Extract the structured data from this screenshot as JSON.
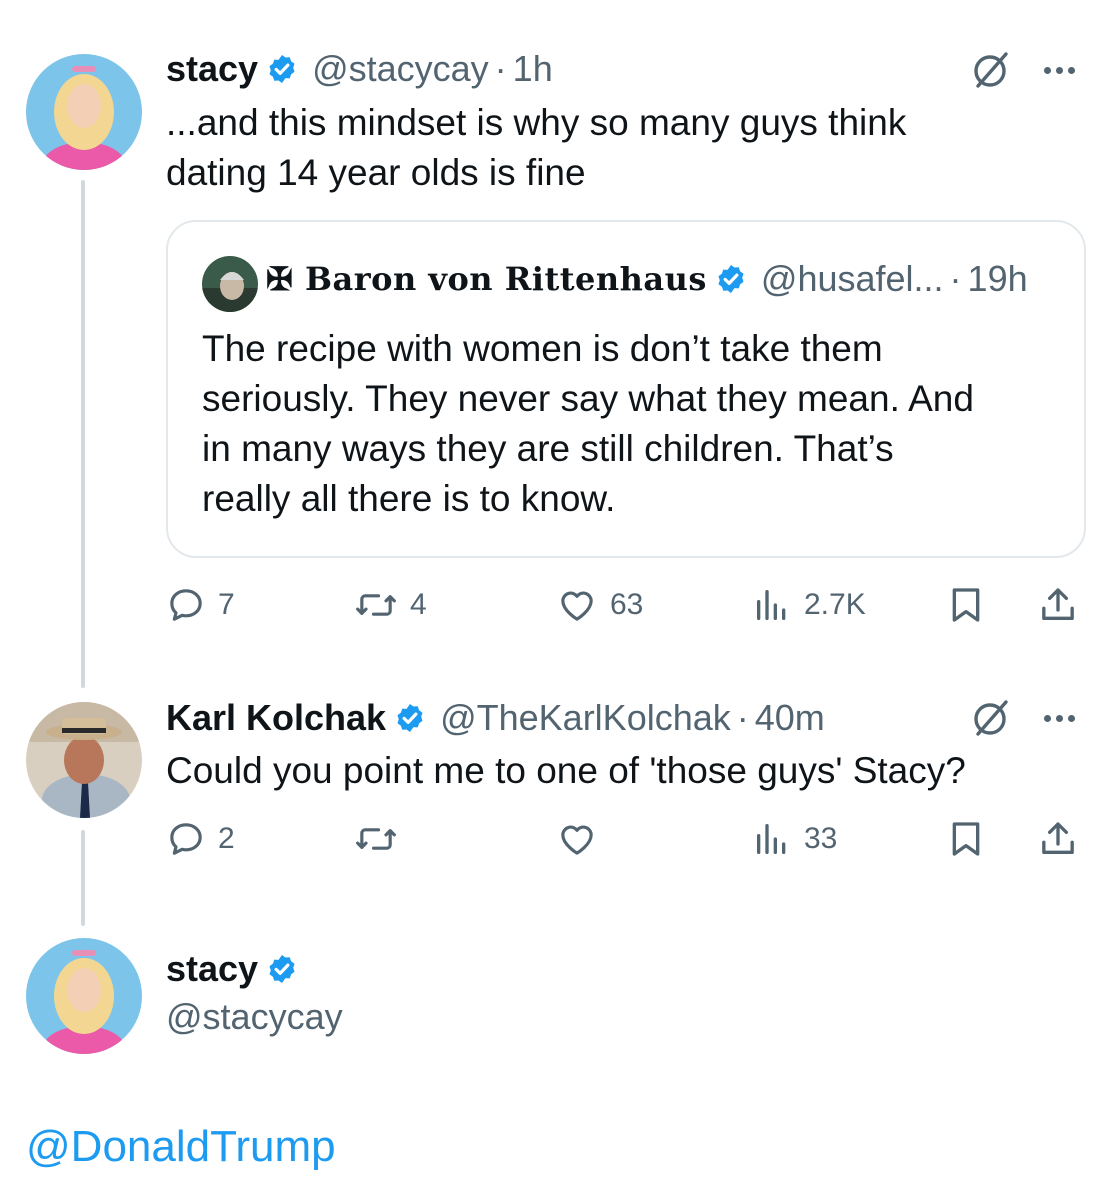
{
  "tweet1": {
    "name": "stacy",
    "handle": "@stacycay",
    "time": "1h",
    "text_line1": "...and this mindset is why so many guys think",
    "text_line2": "dating 14 year olds is fine",
    "quote": {
      "name": "✠ Baron von Rittenhaus",
      "handle": "@husafel...",
      "time": "19h",
      "text_line1": "The recipe with women is don’t take them",
      "text_line2": "seriously. They never say what they mean. And",
      "text_line3": "in many ways they are still children. That’s",
      "text_line4": "really all there is to know."
    },
    "stats": {
      "replies": "7",
      "reposts": "4",
      "likes": "63",
      "views": "2.7K"
    }
  },
  "tweet2": {
    "name": "Karl Kolchak",
    "handle": "@TheKarlKolchak",
    "time": "40m",
    "text": "Could you point me to one of 'those guys' Stacy?",
    "stats": {
      "replies": "2",
      "reposts": "",
      "likes": "",
      "views": "33"
    }
  },
  "tweet3": {
    "name": "stacy",
    "handle": "@stacycay",
    "mention": "@DonaldTrump"
  },
  "colors": {
    "text": "#0f1419",
    "secondary": "#536471",
    "verified": "#1d9bf0",
    "link": "#1d9bf0",
    "thread_line": "#cfd9de",
    "card_border": "#e2e8ec"
  },
  "icons": [
    "verified-badge-icon",
    "grok-icon",
    "more-icon",
    "reply-icon",
    "repost-icon",
    "like-icon",
    "views-icon",
    "bookmark-icon",
    "share-icon"
  ]
}
